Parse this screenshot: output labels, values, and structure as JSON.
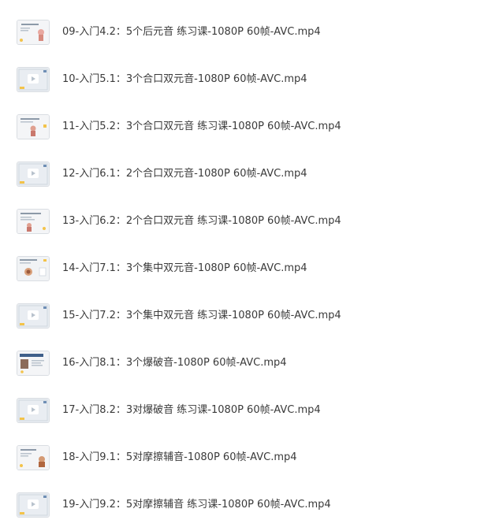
{
  "files": [
    {
      "name": "09-入门4.2：5个后元音 练习课-1080P 60帧-AVC.mp4",
      "thumb_icon": "lesson-slide-thumbnail-icon"
    },
    {
      "name": "10-入门5.1：3个合口双元音-1080P 60帧-AVC.mp4",
      "thumb_icon": "video-thumbnail-icon"
    },
    {
      "name": "11-入门5.2：3个合口双元音 练习课-1080P 60帧-AVC.mp4",
      "thumb_icon": "lesson-slide-thumbnail-icon"
    },
    {
      "name": "12-入门6.1：2个合口双元音-1080P 60帧-AVC.mp4",
      "thumb_icon": "video-thumbnail-icon"
    },
    {
      "name": "13-入门6.2：2个合口双元音 练习课-1080P 60帧-AVC.mp4",
      "thumb_icon": "lesson-slide-thumbnail-icon"
    },
    {
      "name": "14-入门7.1：3个集中双元音-1080P 60帧-AVC.mp4",
      "thumb_icon": "lesson-slide-thumbnail-icon"
    },
    {
      "name": "15-入门7.2：3个集中双元音 练习课-1080P 60帧-AVC.mp4",
      "thumb_icon": "video-thumbnail-icon"
    },
    {
      "name": "16-入门8.1：3个爆破音-1080P 60帧-AVC.mp4",
      "thumb_icon": "lesson-slide-thumbnail-icon"
    },
    {
      "name": "17-入门8.2：3对爆破音 练习课-1080P 60帧-AVC.mp4",
      "thumb_icon": "video-thumbnail-icon"
    },
    {
      "name": "18-入门9.1：5对摩擦辅音-1080P 60帧-AVC.mp4",
      "thumb_icon": "lesson-slide-thumbnail-icon"
    },
    {
      "name": "19-入门9.2：5对摩擦辅音 练习课-1080P 60帧-AVC.mp4",
      "thumb_icon": "video-thumbnail-icon"
    }
  ],
  "colors": {
    "text": "#3a3a3a",
    "thumb_bg": "#e9edf2",
    "thumb_frame": "#cfd6de",
    "play_bg": "#ffffff",
    "accent_yellow": "#f3c34a",
    "accent_blue": "#6f8fb5"
  }
}
